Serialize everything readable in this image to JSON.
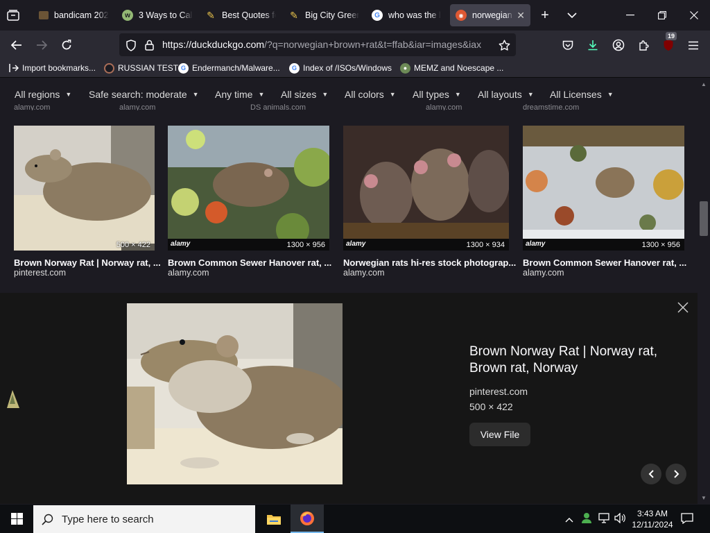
{
  "tabs": [
    {
      "label": "bandicam 202",
      "icon": "bandicam-icon",
      "active": false
    },
    {
      "label": "3 Ways to Calc",
      "icon": "wikihow-icon",
      "active": false
    },
    {
      "label": "Best Quotes fo",
      "icon": "quote-icon",
      "active": false
    },
    {
      "label": "Big City Green",
      "icon": "bigcitygreens-icon",
      "active": false
    },
    {
      "label": "who was the l",
      "icon": "google-icon",
      "active": false
    },
    {
      "label": "norwegian",
      "icon": "duckduckgo-icon",
      "active": true
    }
  ],
  "url": {
    "main": "https://duckduckgo.com",
    "rest": "/?q=norwegian+brown+rat&t=ffab&iar=images&iax"
  },
  "toolbar": {
    "extension_badge": "19"
  },
  "bookmarks": [
    {
      "label": "Import bookmarks...",
      "icon": "import-icon"
    },
    {
      "label": "RUSSIAN TEST",
      "icon": "link-icon"
    },
    {
      "label": "Endermanch/Malware...",
      "icon": "google-icon"
    },
    {
      "label": "Index of /ISOs/Windows",
      "icon": "google-icon"
    },
    {
      "label": "MEMZ and Noescape ...",
      "icon": "memz-icon"
    }
  ],
  "filters": [
    {
      "label": "All regions"
    },
    {
      "label": "Safe search: moderate"
    },
    {
      "label": "Any time"
    },
    {
      "label": "All sizes"
    },
    {
      "label": "All colors"
    },
    {
      "label": "All types"
    },
    {
      "label": "All layouts"
    },
    {
      "label": "All Licenses"
    }
  ],
  "prev_row_sources": [
    "alamy.com",
    "alamy.com",
    "DS animals.com",
    "alamy.com",
    "dreamstime.com"
  ],
  "results": [
    {
      "title": "Brown Norway Rat | Norway rat, ...",
      "source": "pinterest.com",
      "dims": "500 × 422",
      "watermark": ""
    },
    {
      "title": "Brown Common Sewer Hanover rat, ...",
      "source": "alamy.com",
      "dims": "1300 × 956",
      "watermark": "alamy"
    },
    {
      "title": "Norwegian rats hi-res stock photograp...",
      "source": "alamy.com",
      "dims": "1300 × 934",
      "watermark": "alamy"
    },
    {
      "title": "Brown Common Sewer Hanover rat, ...",
      "source": "alamy.com",
      "dims": "1300 × 956",
      "watermark": "alamy"
    }
  ],
  "detail": {
    "title": "Brown Norway Rat | Norway rat, Brown rat, Norway",
    "source": "pinterest.com",
    "dims": "500 × 422",
    "view_file": "View File"
  },
  "taskbar": {
    "search_placeholder": "Type here to search",
    "time": "3:43 AM",
    "date": "12/11/2024"
  }
}
